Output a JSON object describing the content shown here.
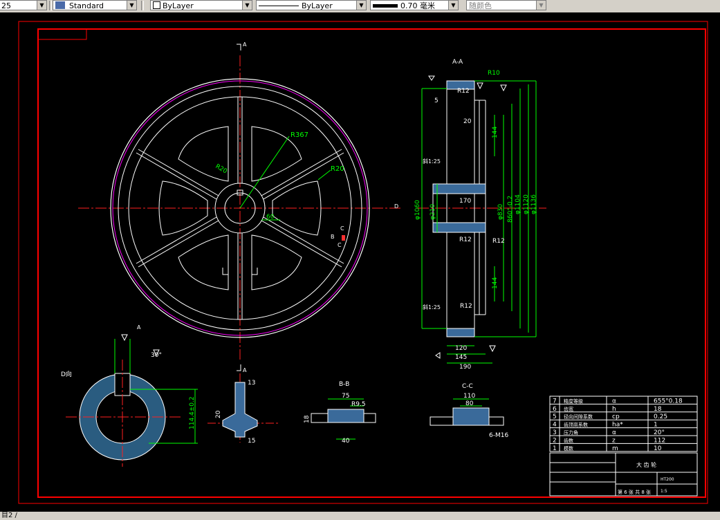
{
  "toolbar": {
    "scale_value": "25",
    "text_style": "Standard",
    "layer_color": "ByLayer",
    "linetype": "ByLayer",
    "lineweight": "0.70 毫米",
    "plot_style": "随颜色"
  },
  "status": {
    "command_line": "目2 /"
  },
  "drawing": {
    "section_aa_title": "A-A",
    "section_bb_title": "B-B",
    "section_cc_title": "C-C",
    "view_d_title": "D向",
    "cut_label_a": "A",
    "cut_label_b": "B",
    "cut_label_c": "C",
    "cut_label_d": "D",
    "main_dims": {
      "r367": "R367",
      "r20": "R20",
      "r20b": "R20",
      "dim60": "60"
    },
    "section_aa": {
      "r10": "R10",
      "r12_top": "R12",
      "r12_mid_left": "R12",
      "r12_mid_right": "R12",
      "r12_bottom": "R12",
      "d5": "5",
      "d20": "20",
      "d144_top": "144",
      "d144_bottom": "144",
      "d170": "170",
      "d120": "120",
      "d145": "145",
      "d190": "190",
      "dia1060": "φ1060",
      "dia210": "φ210",
      "dia830": "φ830",
      "dia860": "860°-0.2",
      "dia1104": "φ1104",
      "dia1120": "φ1120",
      "dia1136": "φ1136",
      "slope_top": "斜1:25",
      "slope_bottom": "斜1:25"
    },
    "view_d": {
      "dia_tol": "114.4±0.2",
      "angle": "30°"
    },
    "small_section": {
      "d13": "13",
      "d20": "20",
      "d15": "15"
    },
    "section_bb": {
      "d75": "75",
      "r95": "R9.5",
      "d18": "18",
      "d40": "40"
    },
    "section_cc": {
      "d110": "110",
      "d80": "80",
      "m16": "6-M16"
    }
  },
  "param_table": {
    "rows": [
      {
        "no": "7",
        "name": "精度等级",
        "symbol": "α",
        "value": "655°0.18"
      },
      {
        "no": "6",
        "name": "齿宽",
        "symbol": "h",
        "value": "18"
      },
      {
        "no": "5",
        "name": "径向间隙系数",
        "symbol": "cp",
        "value": "0.25"
      },
      {
        "no": "4",
        "name": "齿顶高系数",
        "symbol": "ha*",
        "value": "1"
      },
      {
        "no": "3",
        "name": "压力角",
        "symbol": "α",
        "value": "20°"
      },
      {
        "no": "2",
        "name": "齿数",
        "symbol": "z",
        "value": "112"
      },
      {
        "no": "1",
        "name": "模数",
        "symbol": "m",
        "value": "10"
      }
    ]
  },
  "title_block": {
    "part_name": "大 齿 轮",
    "sheet_info": "第 6 张  共 8 张",
    "material": "HT200",
    "scale": "1:5"
  }
}
